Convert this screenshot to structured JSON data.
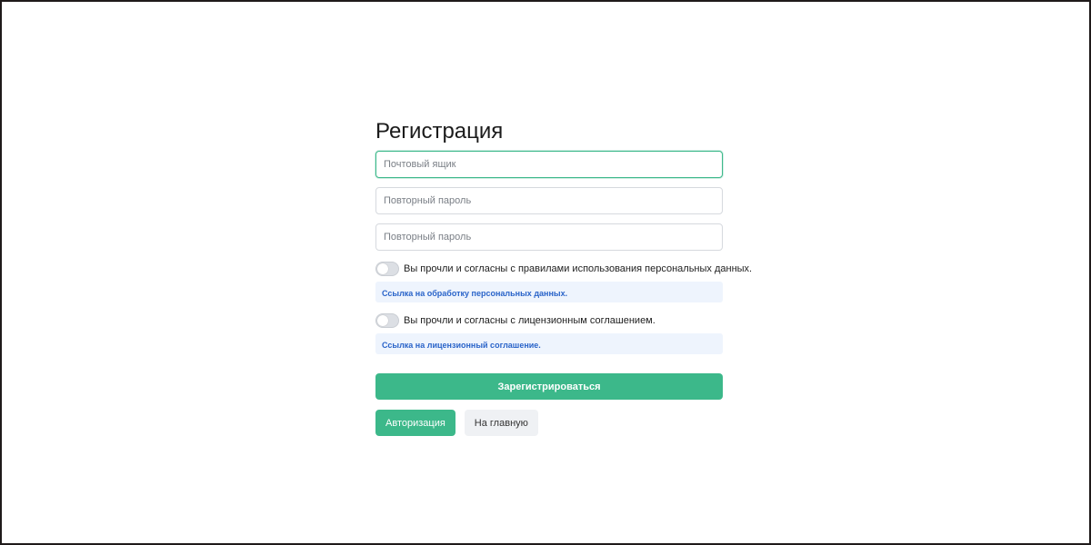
{
  "form": {
    "title": "Регистрация",
    "email_placeholder": "Почтовый ящик",
    "password_placeholder": "Повторный пароль",
    "password_repeat_placeholder": "Повторный пароль"
  },
  "agreements": [
    {
      "label": "Вы прочли и согласны с правилами использования персональных данных.",
      "link": "Ссылка на обработку персональных данных.",
      "checked": false
    },
    {
      "label": "Вы прочли и согласны с лицензионным соглашением.",
      "link": "Ссылка на лицензионный соглашение.",
      "checked": false
    }
  ],
  "actions": {
    "register": "Зарегистрироваться",
    "login": "Авторизация",
    "home": "На главную"
  },
  "colors": {
    "accent": "#3cb88a",
    "link": "#2a64c9",
    "link_bg": "#eef4fd"
  }
}
